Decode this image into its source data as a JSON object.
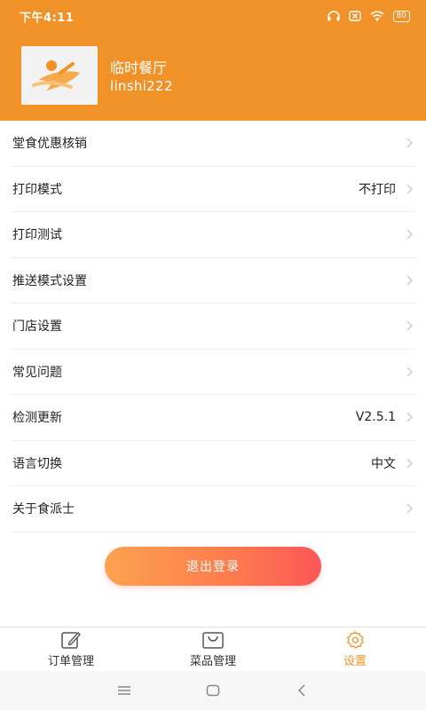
{
  "status_bar": {
    "time": "下午4:11",
    "battery": "80"
  },
  "header": {
    "shop_name": "临时餐厅",
    "account": "linshi222"
  },
  "menu": [
    {
      "label": "堂食优惠核销",
      "value": ""
    },
    {
      "label": "打印模式",
      "value": "不打印"
    },
    {
      "label": "打印测试",
      "value": ""
    },
    {
      "label": "推送模式设置",
      "value": ""
    },
    {
      "label": "门店设置",
      "value": ""
    },
    {
      "label": "常见问题",
      "value": ""
    },
    {
      "label": "检测更新",
      "value": "V2.5.1"
    },
    {
      "label": "语言切换",
      "value": "中文"
    },
    {
      "label": "关于食派士",
      "value": ""
    }
  ],
  "logout_label": "退出登录",
  "tabs": [
    {
      "label": "订单管理",
      "icon": "edit-icon",
      "active": false
    },
    {
      "label": "菜品管理",
      "icon": "bag-icon",
      "active": false
    },
    {
      "label": "设置",
      "icon": "gear-icon",
      "active": true
    }
  ],
  "colors": {
    "brand": "#f09228",
    "button_start": "#fca24f",
    "button_end": "#fb5757"
  }
}
